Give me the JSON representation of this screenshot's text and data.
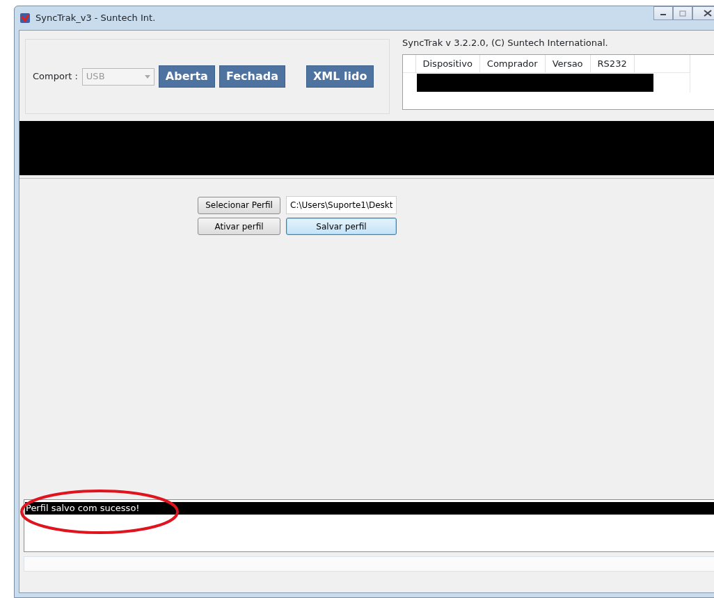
{
  "window": {
    "title": "SyncTrak_v3 - Suntech Int."
  },
  "connection": {
    "label": "Comport :",
    "port": {
      "value": "USB",
      "disabled": true
    },
    "buttons": [
      "Aberta",
      "Fechada",
      "XML lido"
    ]
  },
  "version_text": "SyncTrak v 3.2.2.0, (C) Suntech International.",
  "device_table": {
    "columns": [
      "Dispositivo",
      "Comprador",
      "Versao",
      "RS232"
    ]
  },
  "profile": {
    "select_button": "Selecionar Perfil",
    "path": "C:\\Users\\Suporte1\\Deskt",
    "activate_button": "Ativar perfil",
    "save_button": {
      "label": "Salvar perfil",
      "focused": true
    }
  },
  "log": [
    {
      "text": "Perfil salvo com sucesso!",
      "selected": true
    }
  ]
}
